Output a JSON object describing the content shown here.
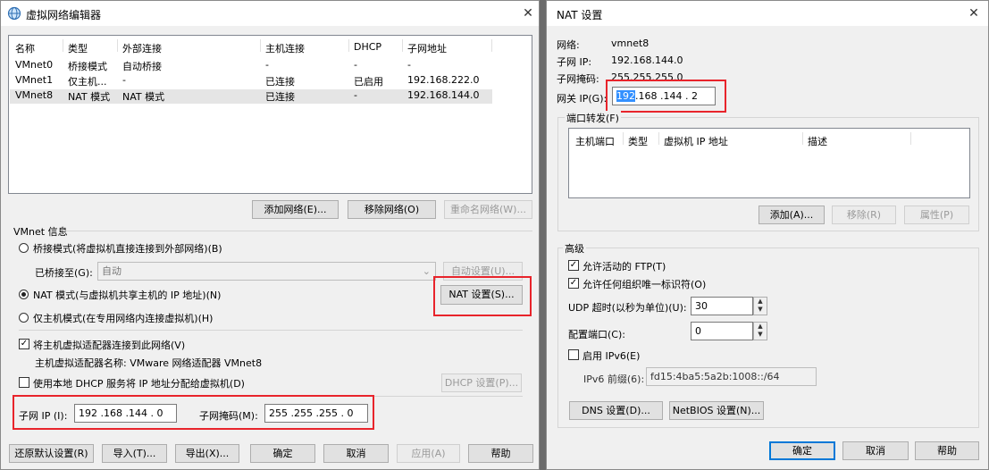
{
  "left": {
    "title": "虚拟网络编辑器",
    "columns": [
      "名称",
      "类型",
      "外部连接",
      "主机连接",
      "DHCP",
      "子网地址"
    ],
    "rows": [
      [
        "VMnet0",
        "桥接模式",
        "自动桥接",
        "-",
        "-",
        "-"
      ],
      [
        "VMnet1",
        "仅主机...",
        "-",
        "已连接",
        "已启用",
        "192.168.222.0"
      ],
      [
        "VMnet8",
        "NAT 模式",
        "NAT 模式",
        "已连接",
        "-",
        "192.168.144.0"
      ]
    ],
    "add_network": "添加网络(E)...",
    "remove_network": "移除网络(O)",
    "rename_network": "重命名网络(W)...",
    "vmnet_info": "VMnet 信息",
    "bridged_mode": "桥接模式(将虚拟机直接连接到外部网络)(B)",
    "bridged_to_label": "已桥接至(G):",
    "bridged_to_value": "自动",
    "auto_settings": "自动设置(U)...",
    "nat_mode": "NAT 模式(与虚拟机共享主机的 IP 地址)(N)",
    "nat_settings": "NAT 设置(S)...",
    "host_only": "仅主机模式(在专用网络内连接虚拟机)(H)",
    "connect_adapter": "将主机虚拟适配器连接到此网络(V)",
    "adapter_name": "主机虚拟适配器名称: VMware 网络适配器 VMnet8",
    "use_dhcp": "使用本地 DHCP 服务将 IP 地址分配给虚拟机(D)",
    "dhcp_settings": "DHCP 设置(P)...",
    "subnet_ip_label": "子网 IP (I):",
    "subnet_ip": "192 .168 .144 . 0",
    "subnet_mask_label": "子网掩码(M):",
    "subnet_mask": "255 .255 .255 . 0",
    "restore_defaults": "还原默认设置(R)",
    "import": "导入(T)...",
    "export": "导出(X)...",
    "ok": "确定",
    "cancel": "取消",
    "apply": "应用(A)",
    "help": "帮助"
  },
  "right": {
    "title": "NAT 设置",
    "network_label": "网络:",
    "network_value": "vmnet8",
    "subnet_ip_label": "子网 IP:",
    "subnet_ip_value": "192.168.144.0",
    "subnet_mask_label": "子网掩码:",
    "subnet_mask_value": "255.255.255.0",
    "gateway_label": "网关 IP(G):",
    "gateway_first": "192",
    "gateway_rest": ".168 .144 . 2",
    "port_forwarding": "端口转发(F)",
    "pf_columns": [
      "主机端口",
      "类型",
      "虚拟机 IP 地址",
      "描述"
    ],
    "add": "添加(A)...",
    "remove": "移除(R)",
    "properties": "属性(P)",
    "advanced": "高级",
    "allow_ftp": "允许活动的 FTP(T)",
    "allow_org_uid": "允许任何组织唯一标识符(O)",
    "udp_timeout_label": "UDP 超时(以秒为单位)(U):",
    "udp_timeout_value": "30",
    "config_port_label": "配置端口(C):",
    "config_port_value": "0",
    "enable_ipv6": "启用 IPv6(E)",
    "ipv6_prefix_label": "IPv6 前缀(6):",
    "ipv6_prefix_value": "fd15:4ba5:5a2b:1008::/64",
    "dns_settings": "DNS 设置(D)...",
    "netbios_settings": "NetBIOS 设置(N)...",
    "ok": "确定",
    "cancel": "取消",
    "help": "帮助"
  },
  "highlight_color": "#e8242b"
}
